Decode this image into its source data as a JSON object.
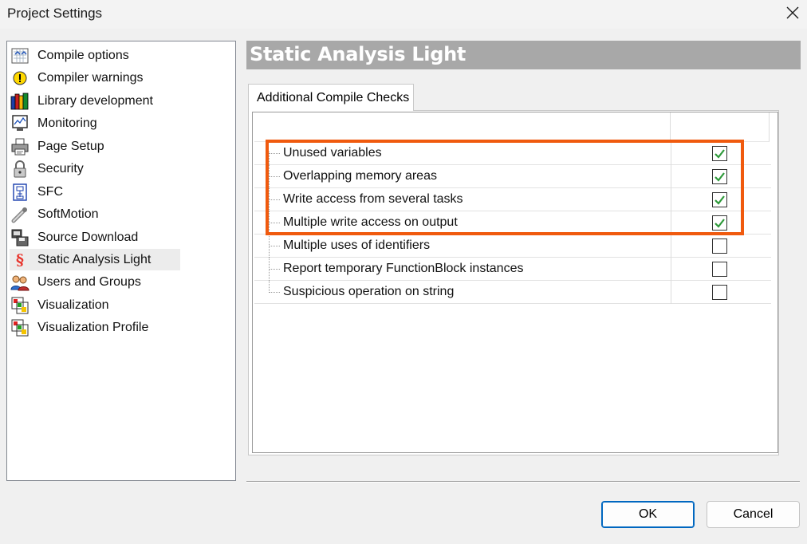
{
  "window": {
    "title": "Project Settings"
  },
  "sidebar": {
    "items": [
      {
        "label": "Compile options",
        "icon": "compile-options-icon"
      },
      {
        "label": "Compiler warnings",
        "icon": "warning-icon"
      },
      {
        "label": "Library development",
        "icon": "library-books-icon"
      },
      {
        "label": "Monitoring",
        "icon": "monitoring-icon"
      },
      {
        "label": "Page Setup",
        "icon": "printer-icon"
      },
      {
        "label": "Security",
        "icon": "lock-icon"
      },
      {
        "label": "SFC",
        "icon": "sfc-icon"
      },
      {
        "label": "SoftMotion",
        "icon": "softmotion-icon"
      },
      {
        "label": "Source Download",
        "icon": "source-download-icon"
      },
      {
        "label": "Static Analysis Light",
        "icon": "section-sign-icon",
        "selected": true
      },
      {
        "label": "Users and Groups",
        "icon": "users-icon"
      },
      {
        "label": "Visualization",
        "icon": "visualization-icon"
      },
      {
        "label": "Visualization Profile",
        "icon": "visualization-profile-icon"
      }
    ]
  },
  "main": {
    "heading": "Static Analysis Light",
    "tab_label": "Additional Compile Checks",
    "checks": [
      {
        "label": "Unused variables",
        "checked": true
      },
      {
        "label": "Overlapping memory areas",
        "checked": true
      },
      {
        "label": "Write access from several tasks",
        "checked": true
      },
      {
        "label": "Multiple write access on output",
        "checked": true
      },
      {
        "label": "Multiple uses of identifiers",
        "checked": false
      },
      {
        "label": "Report temporary FunctionBlock instances",
        "checked": false
      },
      {
        "label": "Suspicious operation on string",
        "checked": false
      }
    ],
    "highlight_color": "#f05a0e",
    "check_color": "#2e9a3a"
  },
  "footer": {
    "ok_label": "OK",
    "cancel_label": "Cancel"
  }
}
